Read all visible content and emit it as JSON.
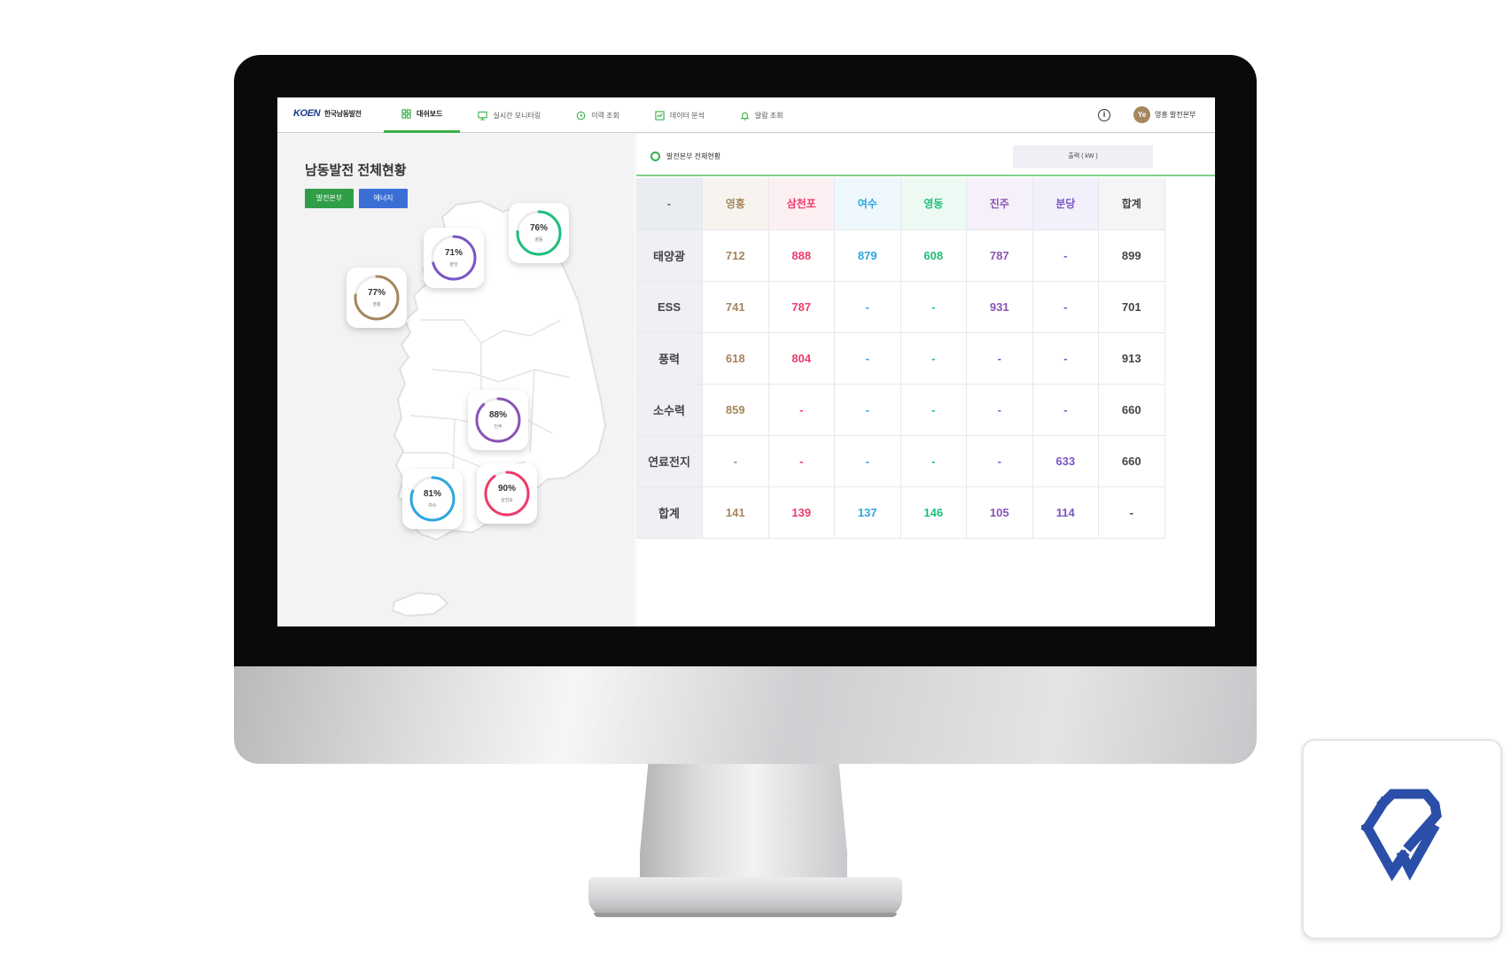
{
  "header": {
    "logo_brand": "KOEN",
    "logo_sub": "한국남동발전",
    "nav": [
      {
        "label": "대쉬보드",
        "icon": "dashboard-icon",
        "active": true
      },
      {
        "label": "실시간 모니터링",
        "icon": "monitor-icon",
        "active": false
      },
      {
        "label": "이력 조회",
        "icon": "history-icon",
        "active": false
      },
      {
        "label": "데이터 분석",
        "icon": "analytics-icon",
        "active": false
      },
      {
        "label": "알람 조회",
        "icon": "bell-icon",
        "active": false
      }
    ],
    "info_icon": "info-icon",
    "avatar_initials": "Ye",
    "user_name": "영흥 발전본부"
  },
  "left": {
    "title": "남동발전 전체현황",
    "btn_primary": "발전본부",
    "btn_secondary": "에너지",
    "gauges": [
      {
        "pct_label": "76%",
        "value": 0.76,
        "site": "영동",
        "color": "#1dbf7c"
      },
      {
        "pct_label": "71%",
        "value": 0.71,
        "site": "분당",
        "color": "#7a55c4"
      },
      {
        "pct_label": "77%",
        "value": 0.77,
        "site": "영흥",
        "color": "#a6865e"
      },
      {
        "pct_label": "88%",
        "value": 0.88,
        "site": "진주",
        "color": "#8a54b6"
      },
      {
        "pct_label": "81%",
        "value": 0.81,
        "site": "여수",
        "color": "#2ba6e0"
      },
      {
        "pct_label": "90%",
        "value": 0.9,
        "site": "삼천포",
        "color": "#f03a6a"
      }
    ]
  },
  "right": {
    "panel_title": "발전본부 전체현황",
    "unit_label": "출력 ( kW )",
    "corner": "-",
    "columns": [
      "영흥",
      "삼천포",
      "여수",
      "영동",
      "진주",
      "분당",
      "합계"
    ],
    "rows": [
      {
        "label": "태양광",
        "cells": [
          "712",
          "888",
          "879",
          "608",
          "787",
          "-",
          "899"
        ]
      },
      {
        "label": "ESS",
        "cells": [
          "741",
          "787",
          "-",
          "-",
          "931",
          "-",
          "701"
        ]
      },
      {
        "label": "풍력",
        "cells": [
          "618",
          "804",
          "-",
          "-",
          "-",
          "-",
          "913"
        ]
      },
      {
        "label": "소수력",
        "cells": [
          "859",
          "-",
          "-",
          "-",
          "-",
          "-",
          "660"
        ]
      },
      {
        "label": "연료전지",
        "cells": [
          "-",
          "-",
          "-",
          "-",
          "-",
          "633",
          "660"
        ]
      },
      {
        "label": "합계",
        "cells": [
          "141",
          "139",
          "137",
          "146",
          "105",
          "114",
          "-"
        ]
      }
    ]
  },
  "colors": {
    "accent_green": "#38b04a",
    "accent_blue": "#3b6fd6",
    "brand_navy": "#1e3c8c",
    "corner_logo": "#2b4fa8"
  },
  "corner_logo_icon": "brand-logo-icon"
}
